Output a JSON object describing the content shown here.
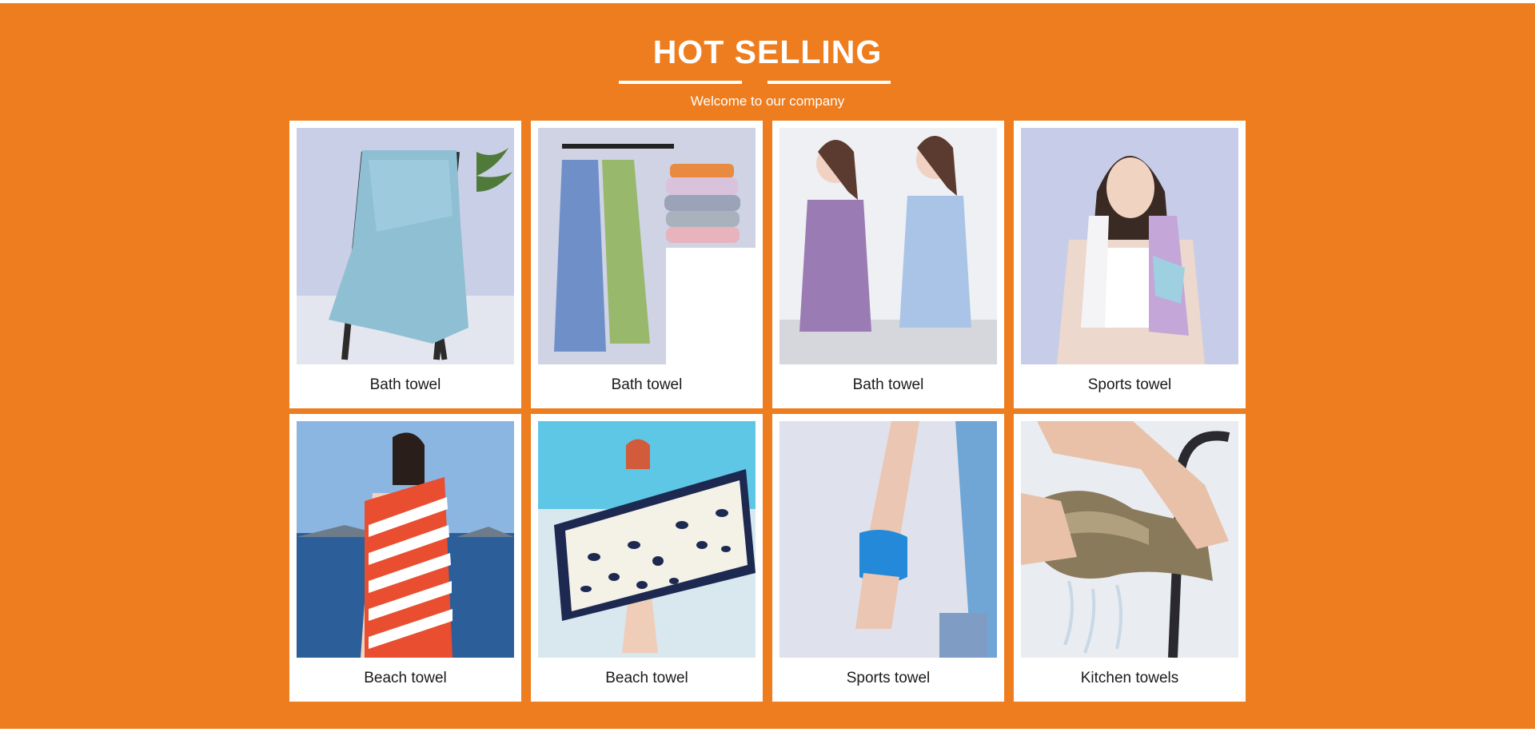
{
  "section": {
    "title": "HOT SELLING",
    "subtitle": "Welcome to our company",
    "background_color": "#ee7d1f"
  },
  "products": [
    {
      "label": "Bath towel",
      "image": "blue-towel-on-chair-image"
    },
    {
      "label": "Bath towel",
      "image": "towels-on-wall-hooks-image"
    },
    {
      "label": "Bath towel",
      "image": "towel-dresses-image"
    },
    {
      "label": "Sports towel",
      "image": "woman-with-sports-towel-image"
    },
    {
      "label": "Beach towel",
      "image": "striped-beach-towel-image"
    },
    {
      "label": "Beach towel",
      "image": "leopard-beach-towel-image"
    },
    {
      "label": "Sports towel",
      "image": "wrist-towel-image"
    },
    {
      "label": "Kitchen towels",
      "image": "wringing-kitchen-towel-image"
    }
  ]
}
